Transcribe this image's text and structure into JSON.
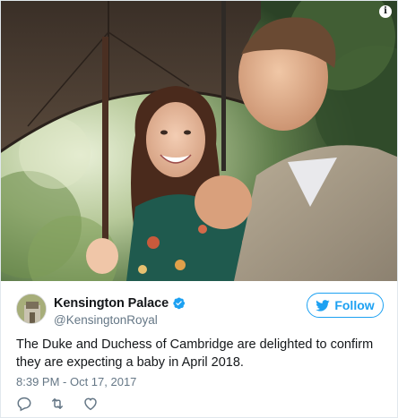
{
  "media": {
    "alt": "Photo of the Duke and Duchess of Cambridge under an umbrella",
    "info_icon": "info-icon",
    "info_glyph": "i"
  },
  "tweet": {
    "display_name": "Kensington Palace",
    "handle": "@KensingtonRoyal",
    "verified_icon": "verified-badge-icon",
    "follow_label": "Follow",
    "text_line1": "The Duke and Duchess of Cambridge are delighted to confirm",
    "text_line2": "they are expecting a baby in April 2018.",
    "timestamp": "8:39 PM - Oct 17, 2017"
  },
  "actions": [
    {
      "icon": "reply-icon"
    },
    {
      "icon": "retweet-icon"
    },
    {
      "icon": "like-heart-icon"
    }
  ],
  "colors": {
    "twitter_blue": "#1da1f2",
    "secondary_text": "#657786",
    "primary_text": "#14171a",
    "border": "#e1e8ed"
  }
}
